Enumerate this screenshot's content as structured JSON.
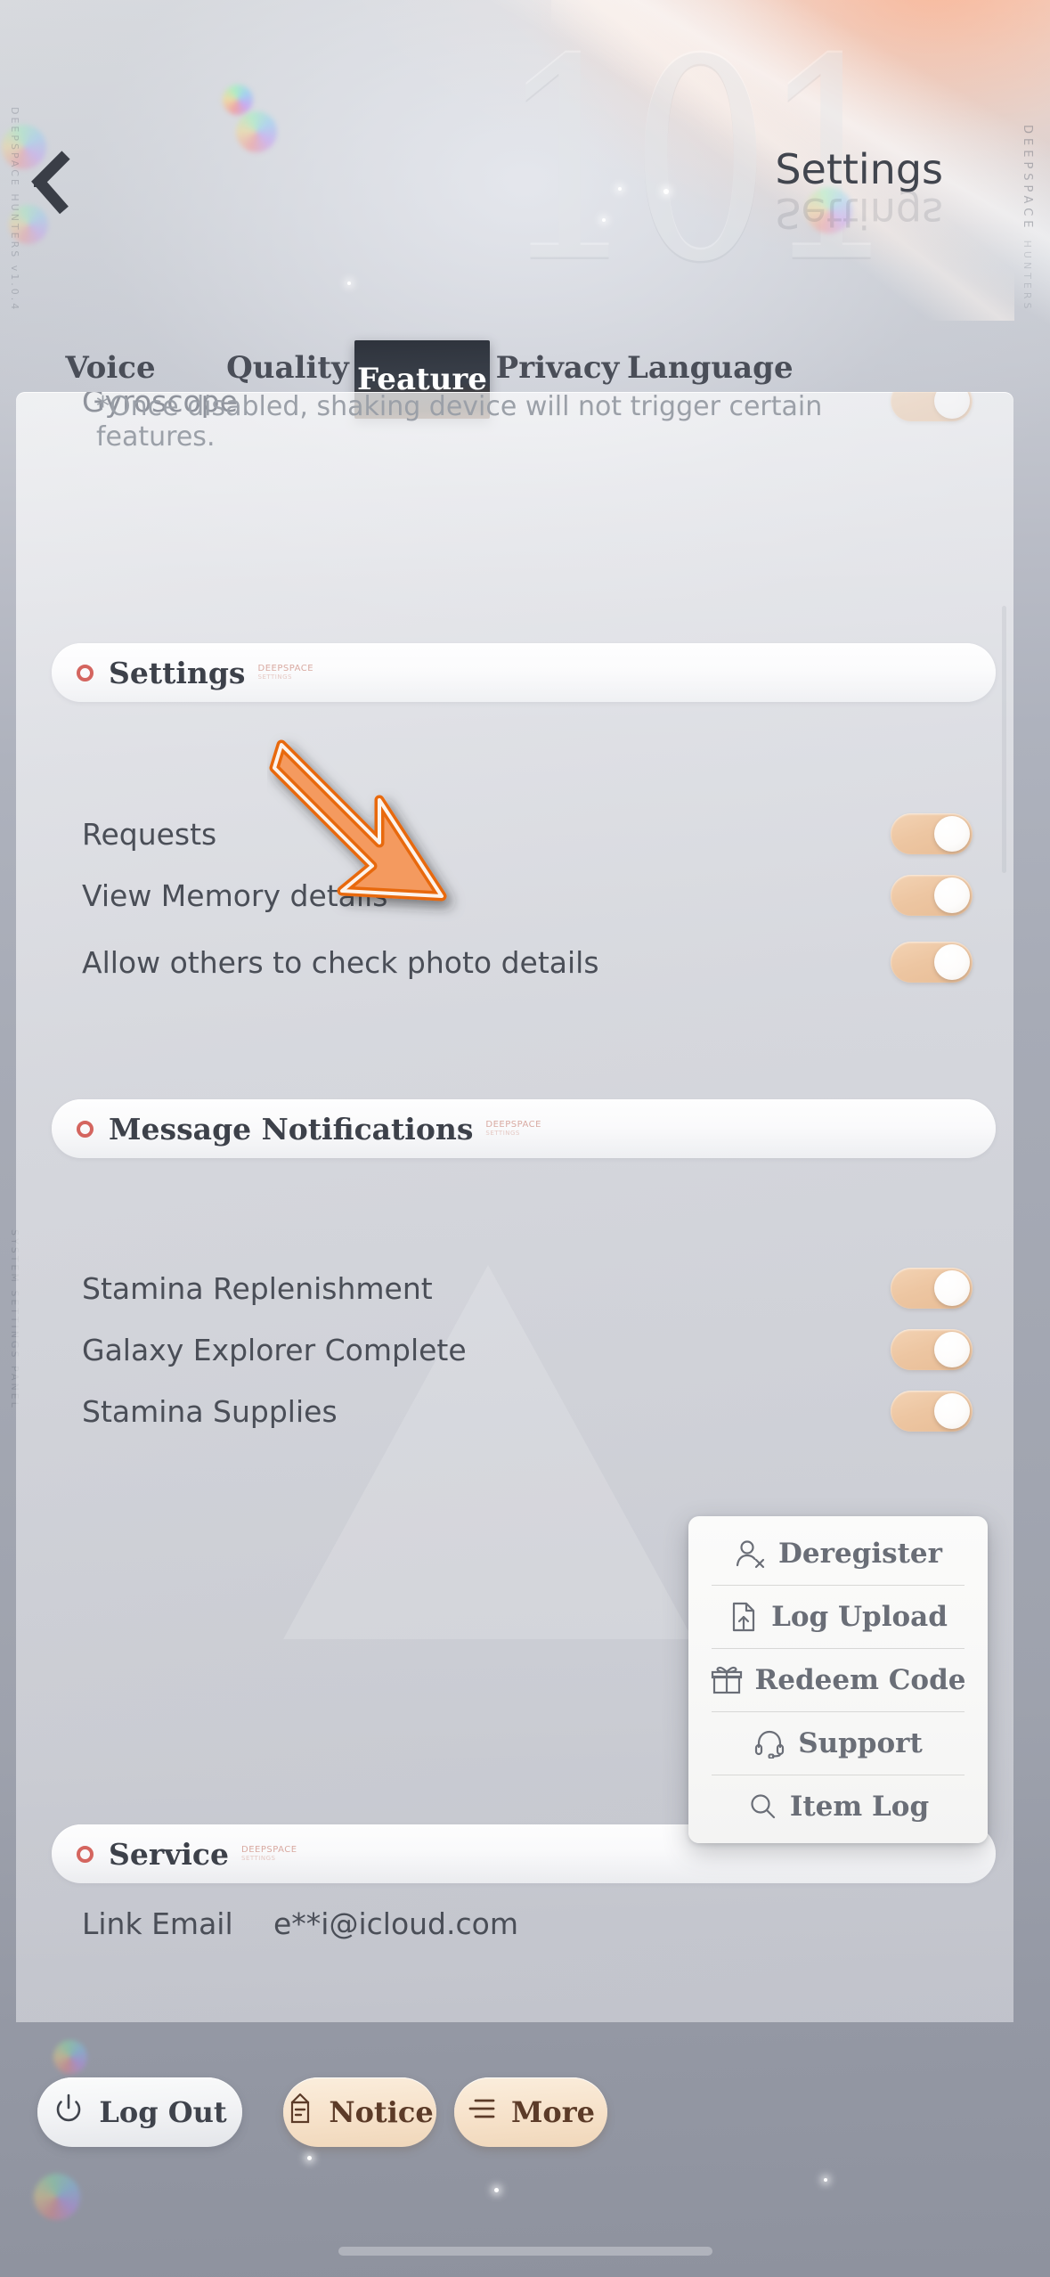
{
  "header": {
    "title": "Settings",
    "back_icon": "back-chevron-icon",
    "brand": "DEEPSPACE",
    "brand_sub": "HUNTERS",
    "watermark_numeral": "101"
  },
  "tabs": [
    {
      "label": "Voice",
      "active": false
    },
    {
      "label": "Quality",
      "active": false
    },
    {
      "label": "Feature",
      "active": true
    },
    {
      "label": "Privacy",
      "active": false
    },
    {
      "label": "Language",
      "active": false
    }
  ],
  "feature": {
    "gyroscope": {
      "label": "Gyroscope",
      "toggle": "on"
    },
    "note": "*Once disabled, shaking device will not trigger certain features."
  },
  "sections": [
    {
      "title": "Settings",
      "deco": "DEEPSPACE",
      "deco_sub": "SETTINGS",
      "rows": [
        {
          "label": "Requests",
          "toggle": "on"
        },
        {
          "label": "View Memory details",
          "toggle": "on"
        },
        {
          "label": "Allow others to check photo details",
          "toggle": "on"
        }
      ]
    },
    {
      "title": "Message Notifications",
      "deco": "DEEPSPACE",
      "deco_sub": "SETTINGS",
      "rows": [
        {
          "label": "Stamina Replenishment",
          "toggle": "on"
        },
        {
          "label": "Galaxy Explorer Complete",
          "toggle": "on"
        },
        {
          "label": "Stamina Supplies",
          "toggle": "on"
        }
      ]
    },
    {
      "title": "Service",
      "deco": "DEEPSPACE",
      "deco_sub": "SETTINGS",
      "rows": []
    }
  ],
  "service": {
    "link_email_label": "Link Email",
    "link_email_value": "e**i@icloud.com"
  },
  "popup_menu": {
    "items": [
      {
        "label": "Deregister",
        "icon": "person-remove-icon"
      },
      {
        "label": "Log Upload",
        "icon": "document-upload-icon"
      },
      {
        "label": "Redeem Code",
        "icon": "gift-icon"
      },
      {
        "label": "Support",
        "icon": "headset-icon"
      },
      {
        "label": "Item Log",
        "icon": "search-icon"
      }
    ]
  },
  "bottom_bar": {
    "log_out": {
      "label": "Log Out",
      "icon": "power-icon"
    },
    "notice": {
      "label": "Notice",
      "icon": "scroll-icon"
    },
    "more": {
      "label": "More",
      "icon": "hamburger-icon"
    }
  },
  "annotation": {
    "arrow": "orange-arrow-pointing-down-right"
  },
  "edge_text": {
    "left_upper": "DEEPSPACE HUNTERS  v1.0.4",
    "left_lower": "SYSTEM SETTINGS PANEL"
  },
  "colors": {
    "accent_peach": "#edc6a2",
    "accent_orange": "#f08a44",
    "tab_active_bg": "#2e333c",
    "section_dot": "#d4655f",
    "text_primary": "#4a4e57",
    "text_muted": "#9ba0a8"
  }
}
